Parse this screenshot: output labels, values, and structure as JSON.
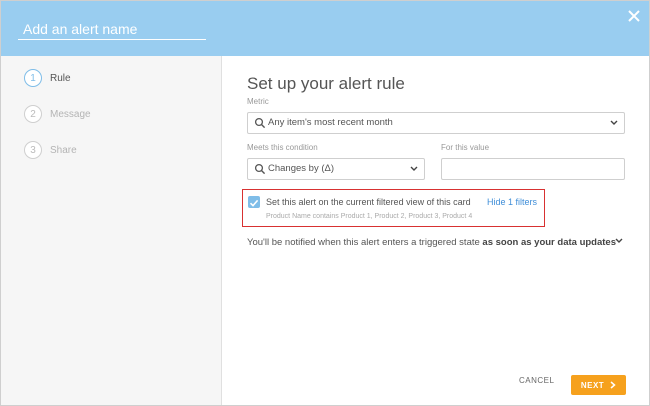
{
  "header": {
    "name_placeholder": "Add an alert name",
    "close_icon": "close-icon"
  },
  "steps": [
    {
      "num": "1",
      "label": "Rule",
      "active": true
    },
    {
      "num": "2",
      "label": "Message",
      "active": false
    },
    {
      "num": "3",
      "label": "Share",
      "active": false
    }
  ],
  "main": {
    "title": "Set up your alert rule",
    "metric_label": "Metric",
    "metric_value": "Any item's most recent month",
    "condition_label": "Meets this condition",
    "condition_value": "Changes by (Δ)",
    "value_label": "For this value",
    "value_value": ""
  },
  "filter": {
    "checked": true,
    "text": "Set this alert on the current filtered view of this card",
    "hide_link": "Hide 1 filters",
    "detail": "Product Name contains Product 1, Product 2, Product 3, Product 4"
  },
  "notify": {
    "prefix": "You'll be notified when this alert enters a triggered state",
    "timing": "as soon as your data updates"
  },
  "footer": {
    "cancel_label": "CANCEL",
    "next_label": "NEXT"
  },
  "colors": {
    "header": "#99cdf0",
    "accent": "#7fbde8",
    "next_button": "#f6a11d",
    "highlight_border": "#d83131",
    "link": "#3f8ed8"
  }
}
